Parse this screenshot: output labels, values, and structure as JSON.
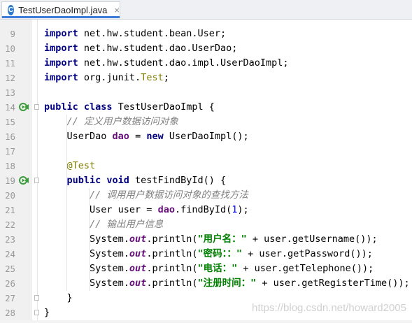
{
  "tab": {
    "icon_letter": "C",
    "title": "TestUserDaoImpl.java",
    "close": "×"
  },
  "lines": [
    {
      "n": "9",
      "tokens": [
        [
          "kw",
          "import"
        ],
        [
          "p",
          " net.hw.student.bean.User;"
        ]
      ]
    },
    {
      "n": "10",
      "tokens": [
        [
          "kw",
          "import"
        ],
        [
          "p",
          " net.hw.student.dao.UserDao;"
        ]
      ]
    },
    {
      "n": "11",
      "tokens": [
        [
          "kw",
          "import"
        ],
        [
          "p",
          " net.hw.student.dao.impl.UserDaoImpl;"
        ]
      ]
    },
    {
      "n": "12",
      "tokens": [
        [
          "kw",
          "import"
        ],
        [
          "p",
          " org.junit."
        ],
        [
          "cls",
          "Test"
        ],
        [
          "p",
          ";"
        ]
      ]
    },
    {
      "n": "13",
      "tokens": []
    },
    {
      "n": "14",
      "run": true,
      "tokens": [
        [
          "kw",
          "public class"
        ],
        [
          "p",
          " TestUserDaoImpl {"
        ]
      ]
    },
    {
      "n": "15",
      "tokens": [
        [
          "p",
          "    "
        ],
        [
          "cm",
          "// 定义用户数据访问对象"
        ]
      ]
    },
    {
      "n": "16",
      "tokens": [
        [
          "p",
          "    UserDao "
        ],
        [
          "fld",
          "dao"
        ],
        [
          "p",
          " = "
        ],
        [
          "kw",
          "new"
        ],
        [
          "p",
          " UserDaoImpl();"
        ]
      ]
    },
    {
      "n": "17",
      "tokens": []
    },
    {
      "n": "18",
      "tokens": [
        [
          "p",
          "    "
        ],
        [
          "an",
          "@Test"
        ]
      ]
    },
    {
      "n": "19",
      "run": true,
      "tokens": [
        [
          "p",
          "    "
        ],
        [
          "kw",
          "public void"
        ],
        [
          "p",
          " testFindById() {"
        ]
      ]
    },
    {
      "n": "20",
      "tokens": [
        [
          "p",
          "        "
        ],
        [
          "cm",
          "// 调用用户数据访问对象的查找方法"
        ]
      ]
    },
    {
      "n": "21",
      "tokens": [
        [
          "p",
          "        User user = "
        ],
        [
          "fld",
          "dao"
        ],
        [
          "p",
          ".findById("
        ],
        [
          "num",
          "1"
        ],
        [
          "p",
          ");"
        ]
      ]
    },
    {
      "n": "22",
      "tokens": [
        [
          "p",
          "        "
        ],
        [
          "cm",
          "// 输出用户信息"
        ]
      ]
    },
    {
      "n": "23",
      "tokens": [
        [
          "p",
          "        System."
        ],
        [
          "sfld",
          "out"
        ],
        [
          "p",
          ".println("
        ],
        [
          "st",
          "\"用户名：\""
        ],
        [
          "p",
          " + user.getUsername());"
        ]
      ]
    },
    {
      "n": "24",
      "tokens": [
        [
          "p",
          "        System."
        ],
        [
          "sfld",
          "out"
        ],
        [
          "p",
          ".println("
        ],
        [
          "st",
          "\"密码：：\""
        ],
        [
          "p",
          " + user.getPassword());"
        ]
      ]
    },
    {
      "n": "25",
      "tokens": [
        [
          "p",
          "        System."
        ],
        [
          "sfld",
          "out"
        ],
        [
          "p",
          ".println("
        ],
        [
          "st",
          "\"电话：\""
        ],
        [
          "p",
          " + user.getTelephone());"
        ]
      ]
    },
    {
      "n": "26",
      "tokens": [
        [
          "p",
          "        System."
        ],
        [
          "sfld",
          "out"
        ],
        [
          "p",
          ".println("
        ],
        [
          "st",
          "\"注册时间：\""
        ],
        [
          "p",
          " + user.getRegisterTime());"
        ]
      ]
    },
    {
      "n": "27",
      "tokens": [
        [
          "p",
          "    }"
        ]
      ]
    },
    {
      "n": "28",
      "tokens": [
        [
          "p",
          "}"
        ]
      ]
    }
  ],
  "watermark": "https://blog.csdn.net/howard2005",
  "colors": {
    "keyword": "#000080",
    "comment": "#808080",
    "annotation": "#808000",
    "string": "#008000",
    "number": "#0000ff",
    "field": "#660e7a",
    "run_icon": "#3a9c3a",
    "tab_accent": "#3f7cd9"
  }
}
